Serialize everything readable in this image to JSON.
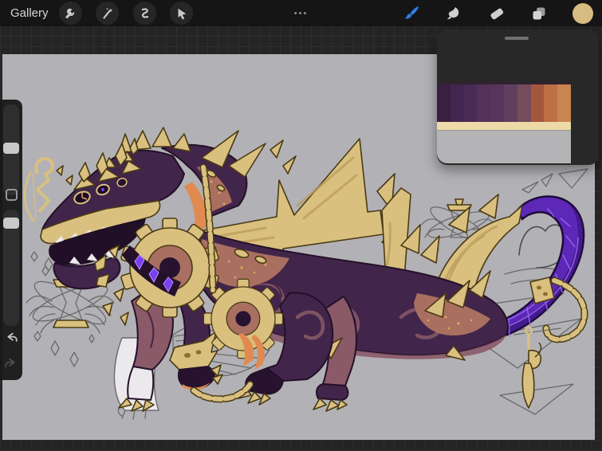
{
  "toolbar": {
    "gallery_label": "Gallery",
    "menu_dots": "•••",
    "left_tools": [
      "actions-wrench",
      "adjustments-magic-wand",
      "selection",
      "transform-arrow"
    ],
    "right_tools": [
      "paint-brush",
      "smudge",
      "eraser",
      "layers",
      "color-swatch"
    ],
    "active_tool": "paint-brush",
    "active_tool_color": "#2f7de1",
    "color_swatch": "#d6bc80"
  },
  "sidebar": {
    "controls": [
      "brush-size-slider",
      "modify-button",
      "brush-opacity-slider",
      "undo-button",
      "redo-button"
    ],
    "undo_enabled": true,
    "redo_enabled": false
  },
  "reference_panel": {
    "kind": "floating-reference-window",
    "image": {
      "description": "color palette reference image on light gray",
      "background": "#b4b3b6",
      "top_edge_color": "#32232f",
      "palette_colors": [
        "#3a2040",
        "#432750",
        "#482b55",
        "#54305a",
        "#57355b",
        "#5f3f5e",
        "#744c5a",
        "#a5573e",
        "#bf6f44",
        "#c98551"
      ],
      "cream_band": "#eddaa8"
    }
  },
  "canvas": {
    "background": "#b2b1b5",
    "artwork": "dragon character concept: dark purple dragon with gold gear collar, crown spikes, chains, gold angular wings, glowing purple crescent grid tail with gold key, and pencil-sketch winged hourglass doodles"
  },
  "theme": {
    "toolbar_bg": "#151515",
    "app_bg": "#242424",
    "grid_line": "#2e2e2e",
    "icon_gray": "#c9c9c9",
    "sidebar_bg": "#1d1d1d",
    "panel_bg": "#282828",
    "canvas_bg": "#b2b1b5",
    "gold": "#d9c07f",
    "gold_mid": "#b89a55",
    "gold_line": "#4a3a14",
    "purple_dark": "#42254a",
    "purple_deep": "#271330",
    "mauve": "#8a5a68",
    "rose": "#a96f60",
    "speckle": "#e9a35f",
    "orange": "#e08a50",
    "tail": "#5d28b8",
    "tail_light": "#9b6df2",
    "white_art": "#ece9ec",
    "sketch": "#6a6a6a",
    "blue": "#2f7de1"
  }
}
